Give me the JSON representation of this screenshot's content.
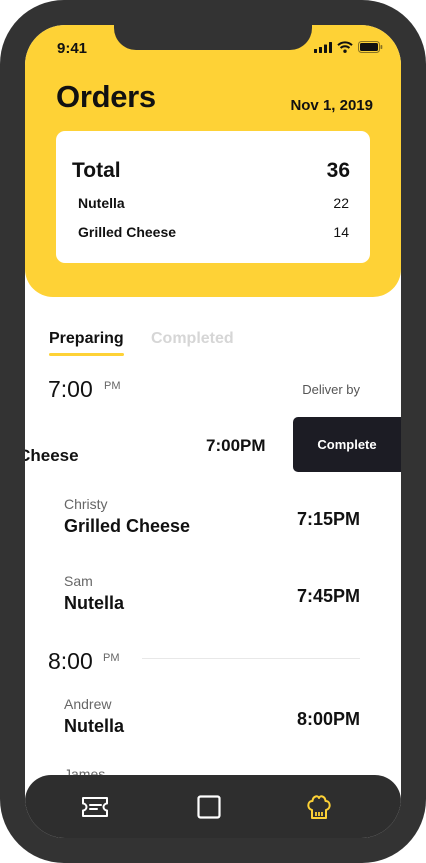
{
  "status_bar": {
    "time": "9:41"
  },
  "header": {
    "title": "Orders",
    "date": "Nov 1, 2019"
  },
  "summary": {
    "total_label": "Total",
    "total_value": "36",
    "rows": [
      {
        "label": "Nutella",
        "value": "22"
      },
      {
        "label": "Grilled Cheese",
        "value": "14"
      }
    ]
  },
  "tabs": [
    {
      "label": "Preparing",
      "active": true
    },
    {
      "label": "Completed",
      "active": false
    }
  ],
  "deliver_by_label": "Deliver by",
  "slots": [
    {
      "hour": "7:00",
      "suffix": "PM"
    },
    {
      "hour": "8:00",
      "suffix": "PM"
    }
  ],
  "swiped_order": {
    "item_partial": "d Cheese",
    "time": "7:00PM",
    "action_label": "Complete"
  },
  "orders": [
    {
      "customer": "Christy",
      "item": "Grilled Cheese",
      "time": "7:15PM"
    },
    {
      "customer": "Sam",
      "item": "Nutella",
      "time": "7:45PM"
    },
    {
      "customer": "Andrew",
      "item": "Nutella",
      "time": "8:00PM"
    },
    {
      "customer": "James",
      "item": "",
      "time": ""
    }
  ],
  "tab_bar": {
    "items": [
      {
        "icon": "ticket-icon",
        "active": false
      },
      {
        "icon": "square-icon",
        "active": false
      },
      {
        "icon": "chef-hat-icon",
        "active": true
      }
    ]
  },
  "colors": {
    "accent": "#fed236",
    "dark": "#1c1c24",
    "frame": "#333333"
  }
}
